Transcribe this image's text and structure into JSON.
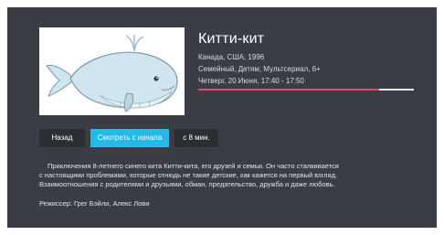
{
  "movie": {
    "title": "Китти-кит",
    "meta_country_year": "Канада, США, 1996",
    "meta_genres": "Семейный, Детям, Мультсериал, 6+",
    "meta_schedule": "Четверг, 20 Июня, 17:40 - 17:50",
    "progress_fraction": 0.84,
    "description_lines": [
      "Приключения 8-летнего синего кита Китти-кита, его друзей и семьи. Он часто сталкивается",
      "с настоящими проблемами, которые отнюдь не такие детские, как кажется на первый взгляд.",
      "Взаимоотношения с родителями и друзьями, обман, предательство, дружба и даже любовь."
    ],
    "director": "Режиссер: Грег Бэйли, Алекс Лови"
  },
  "actions": {
    "back_label": "Назад",
    "restart_label": "Смотреть с начала",
    "skip_label": "с 8 мин."
  },
  "colors": {
    "background": "#3a3e44",
    "accent_button": "#25b8e8",
    "progress": "#d9506f",
    "progress_track": "#e9e9e9"
  },
  "icons": {
    "poster": "whale-illustration"
  }
}
